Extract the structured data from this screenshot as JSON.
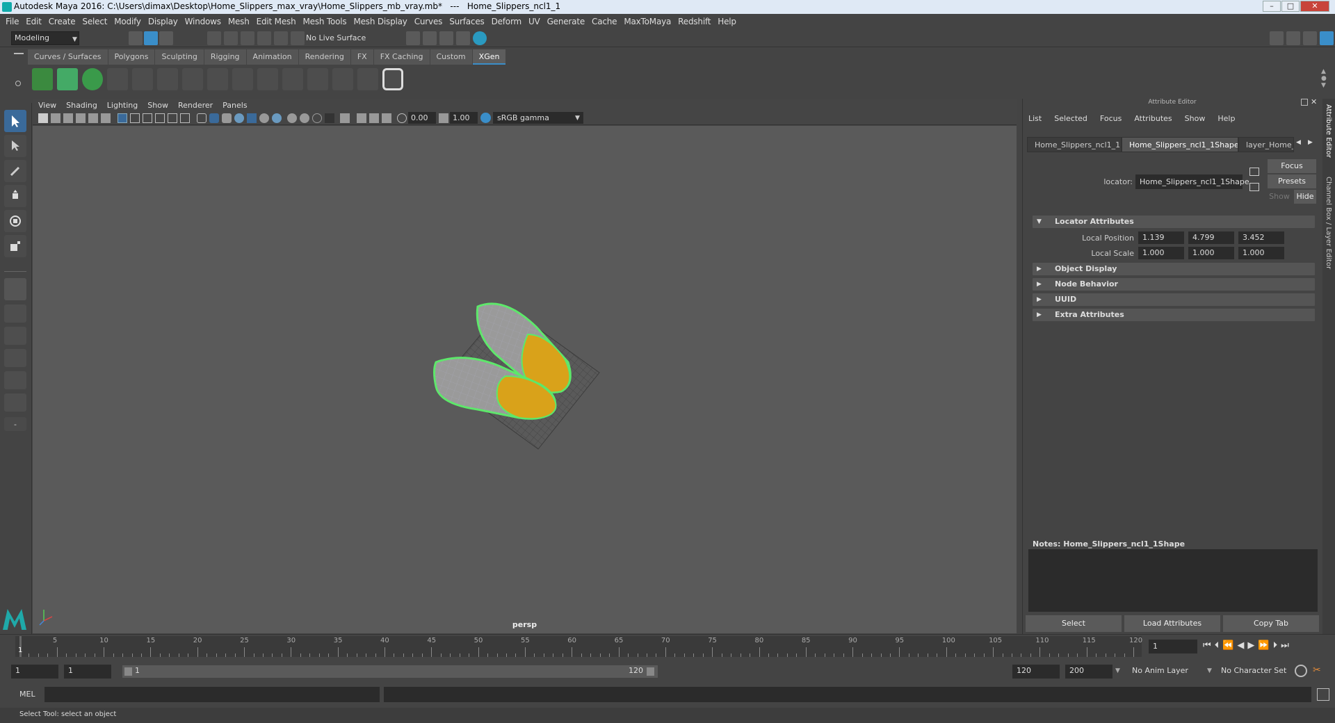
{
  "titlebar": {
    "title": "Autodesk Maya 2016: C:\\Users\\dimax\\Desktop\\Home_Slippers_max_vray\\Home_Slippers_mb_vray.mb*   ---   Home_Slippers_ncl1_1"
  },
  "menubar": [
    "File",
    "Edit",
    "Create",
    "Select",
    "Modify",
    "Display",
    "Windows",
    "Mesh",
    "Edit Mesh",
    "Mesh Tools",
    "Mesh Display",
    "Curves",
    "Surfaces",
    "Deform",
    "UV",
    "Generate",
    "Cache",
    "MaxToMaya",
    "Redshift",
    "Help"
  ],
  "status": {
    "mode": "Modeling",
    "live_surface": "No Live Surface"
  },
  "shelf_tabs": [
    "Curves / Surfaces",
    "Polygons",
    "Sculpting",
    "Rigging",
    "Animation",
    "Rendering",
    "FX",
    "FX Caching",
    "Custom",
    "XGen"
  ],
  "shelf_active": "XGen",
  "viewport": {
    "menu": [
      "View",
      "Shading",
      "Lighting",
      "Show",
      "Renderer",
      "Panels"
    ],
    "exposure": "0.00",
    "gamma": "1.00",
    "color_space": "sRGB gamma",
    "camera": "persp"
  },
  "attr_editor": {
    "title": "Attribute Editor",
    "menu": [
      "List",
      "Selected",
      "Focus",
      "Attributes",
      "Show",
      "Help"
    ],
    "tabs": [
      "Home_Slippers_ncl1_1",
      "Home_Slippers_ncl1_1Shape",
      "layer_Home_S"
    ],
    "active_tab": "Home_Slippers_ncl1_1Shape",
    "node_label": "locator:",
    "node_value": "Home_Slippers_ncl1_1Shape",
    "focus_btn": "Focus",
    "presets_btn": "Presets",
    "show_btn": "Show",
    "hide_btn": "Hide",
    "sections": [
      {
        "label": "Locator Attributes",
        "expanded": true
      },
      {
        "label": "Object Display",
        "expanded": false
      },
      {
        "label": "Node Behavior",
        "expanded": false
      },
      {
        "label": "UUID",
        "expanded": false
      },
      {
        "label": "Extra Attributes",
        "expanded": false
      }
    ],
    "local_position": {
      "label": "Local Position",
      "x": "1.139",
      "y": "4.799",
      "z": "3.452"
    },
    "local_scale": {
      "label": "Local Scale",
      "x": "1.000",
      "y": "1.000",
      "z": "1.000"
    },
    "notes_label": "Notes:  Home_Slippers_ncl1_1Shape",
    "buttons": [
      "Select",
      "Load Attributes",
      "Copy Tab"
    ]
  },
  "side_tabs": [
    "Attribute Editor",
    "Channel Box / Layer Editor"
  ],
  "timeline": {
    "ticks": [
      "1",
      "5",
      "10",
      "15",
      "20",
      "25",
      "30",
      "35",
      "40",
      "45",
      "50",
      "55",
      "60",
      "65",
      "70",
      "75",
      "80",
      "85",
      "90",
      "95",
      "100",
      "105",
      "110",
      "115",
      "120"
    ],
    "current_frame": "1"
  },
  "range": {
    "start": "1",
    "playback_start": "1",
    "slider_start": "1",
    "slider_end": "120",
    "playback_end": "120",
    "end": "200",
    "anim_layer": "No Anim Layer",
    "char_set": "No Character Set"
  },
  "mel": {
    "label": "MEL"
  },
  "helpline": "Select Tool: select an object",
  "colors": {
    "accent": "#3a8ec9",
    "wire": "#5de86a",
    "sole": "#d9a21a"
  }
}
